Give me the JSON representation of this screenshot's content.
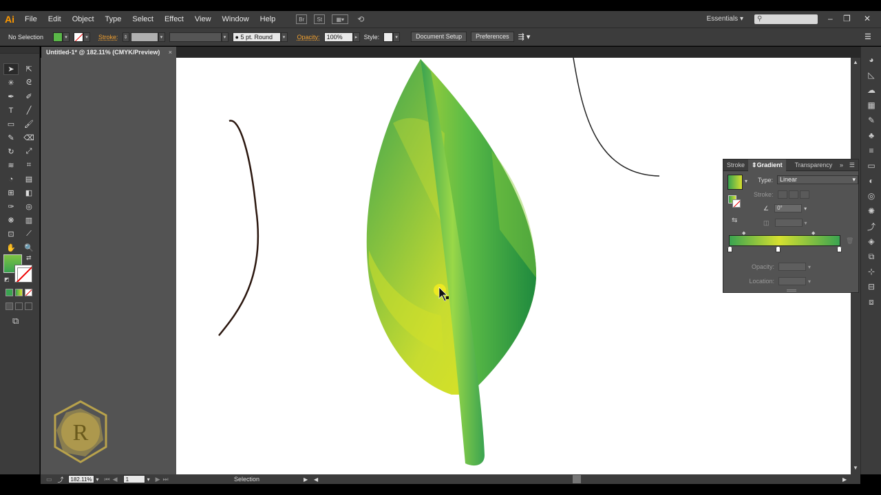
{
  "app": {
    "logo": "Ai"
  },
  "menu": [
    "File",
    "Edit",
    "Object",
    "Type",
    "Select",
    "Effect",
    "View",
    "Window",
    "Help"
  ],
  "menu_icons": {
    "bridge": "Br",
    "stock": "St"
  },
  "workspace_switcher": "Essentials",
  "control_bar": {
    "selection_status": "No Selection",
    "stroke_label": "Stroke:",
    "brush_definition": "5 pt. Round",
    "opacity_label": "Opacity:",
    "opacity_value": "100%",
    "style_label": "Style:",
    "document_setup": "Document Setup",
    "preferences": "Preferences"
  },
  "document_tab": {
    "title": "Untitled-1* @ 182.11% (CMYK/Preview)",
    "close": "×"
  },
  "gradient_panel": {
    "tabs": [
      "Stroke",
      "Gradient",
      "Transparency"
    ],
    "active_tab": "Gradient",
    "type_label": "Type:",
    "type_value": "Linear",
    "stroke_label": "Stroke:",
    "angle_value": "0°",
    "opacity_label": "Opacity:",
    "location_label": "Location:",
    "gradient_colors": [
      "#3aa350",
      "#d6e030",
      "#3aa350"
    ]
  },
  "status_bar": {
    "zoom": "182.11%",
    "artboard_number": "1",
    "tool_name": "Selection"
  },
  "colors": {
    "fill": "#5ab848",
    "accent": "#ff9a00"
  },
  "watermark": {
    "letter": "R"
  }
}
